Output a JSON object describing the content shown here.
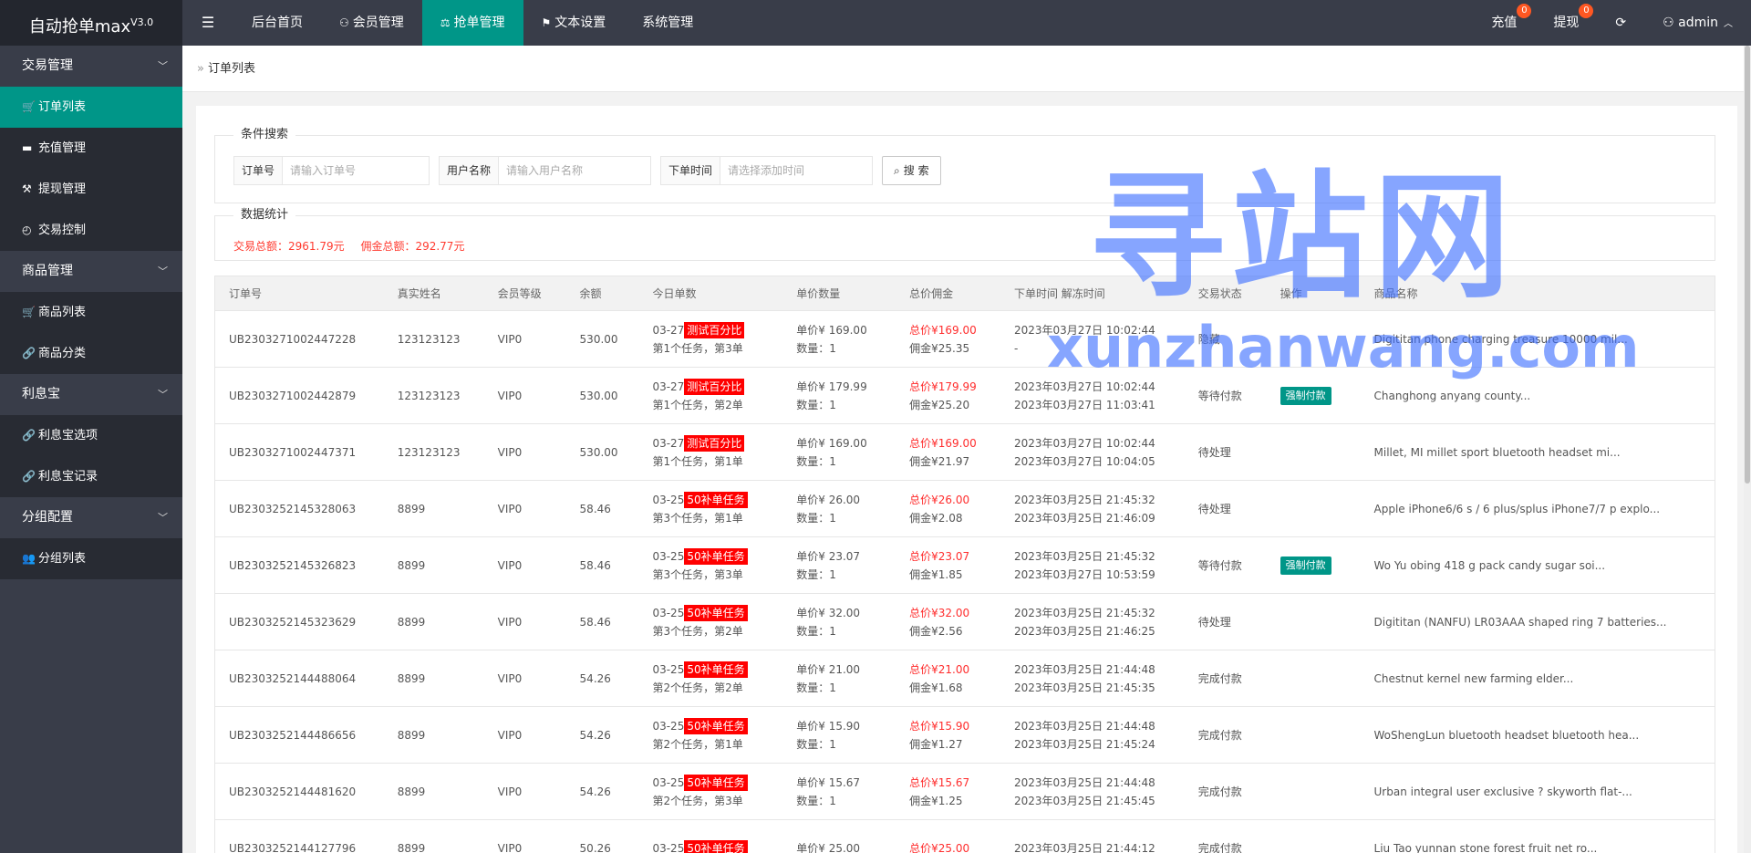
{
  "header": {
    "logo": "自动抢单max",
    "version": "V3.0",
    "menu_toggle_icon": "menu-icon",
    "nav": [
      {
        "label": "后台首页",
        "icon": ""
      },
      {
        "label": "会员管理",
        "icon": "user-icon"
      },
      {
        "label": "抢单管理",
        "icon": "balance-scale-icon"
      },
      {
        "label": "文本设置",
        "icon": "flag-icon"
      },
      {
        "label": "系统管理",
        "icon": ""
      }
    ],
    "active_nav": "抢单管理",
    "right": {
      "recharge": {
        "label": "充值",
        "badge": "0"
      },
      "withdraw": {
        "label": "提现",
        "badge": "0"
      },
      "refresh_icon": "refresh-icon",
      "user": "admin"
    }
  },
  "sidebar": {
    "groups": [
      {
        "label": "交易管理",
        "items": [
          {
            "label": "订单列表",
            "icon": "cart-icon",
            "active": true
          },
          {
            "label": "充值管理",
            "icon": "card-icon"
          },
          {
            "label": "提现管理",
            "icon": "hammer-icon"
          },
          {
            "label": "交易控制",
            "icon": "dashboard-icon"
          }
        ]
      },
      {
        "label": "商品管理",
        "items": [
          {
            "label": "商品列表",
            "icon": "cart-icon"
          },
          {
            "label": "商品分类",
            "icon": "link-icon"
          }
        ]
      },
      {
        "label": "利息宝",
        "items": [
          {
            "label": "利息宝选项",
            "icon": "link-icon"
          },
          {
            "label": "利息宝记录",
            "icon": "link-icon"
          }
        ]
      },
      {
        "label": "分组配置",
        "items": [
          {
            "label": "分组列表",
            "icon": "users-icon"
          }
        ]
      }
    ]
  },
  "breadcrumb": "订单列表",
  "search": {
    "legend": "条件搜索",
    "order_label": "订单号",
    "order_placeholder": "请输入订单号",
    "user_label": "用户名称",
    "user_placeholder": "请输入用户名称",
    "time_label": "下单时间",
    "time_placeholder": "请选择添加时间",
    "button": "搜 索"
  },
  "stats": {
    "legend": "数据统计",
    "total_trade": "交易总额：2961.79元",
    "total_commission": "佣金总额：292.77元"
  },
  "table": {
    "headers": [
      "订单号",
      "真实姓名",
      "会员等级",
      "余额",
      "今日单数",
      "单价数量",
      "总价佣金",
      "下单时间 解冻时间",
      "交易状态",
      "操作",
      "商品名称"
    ],
    "rows": [
      {
        "id": "UB2303271002447228",
        "name": "123123123",
        "level": "VIP0",
        "balance": "530.00",
        "date": "03-27",
        "tag": "测试百分比",
        "task": "第1个任务，第3单",
        "price": "单价¥  169.00",
        "qty": "数量：1",
        "total": "总价¥169.00",
        "commission": "佣金¥25.35",
        "time1": "2023年03月27日 10:02:44",
        "time2": "-",
        "status": "隐藏",
        "action": "",
        "product": "Digititan phone charging treasure 10000 mil..."
      },
      {
        "id": "UB2303271002442879",
        "name": "123123123",
        "level": "VIP0",
        "balance": "530.00",
        "date": "03-27",
        "tag": "测试百分比",
        "task": "第1个任务，第2单",
        "price": "单价¥  179.99",
        "qty": "数量：1",
        "total": "总价¥179.99",
        "commission": "佣金¥25.20",
        "time1": "2023年03月27日 10:02:44",
        "time2": "2023年03月27日 11:03:41",
        "status": "等待付款",
        "action": "强制付款",
        "product": "Changhong anyang county..."
      },
      {
        "id": "UB2303271002447371",
        "name": "123123123",
        "level": "VIP0",
        "balance": "530.00",
        "date": "03-27",
        "tag": "测试百分比",
        "task": "第1个任务，第1单",
        "price": "单价¥  169.00",
        "qty": "数量：1",
        "total": "总价¥169.00",
        "commission": "佣金¥21.97",
        "time1": "2023年03月27日 10:02:44",
        "time2": "2023年03月27日 10:04:05",
        "status": "待处理",
        "action": "",
        "product": "Millet, MI millet sport bluetooth headset mi..."
      },
      {
        "id": "UB2303252145328063",
        "name": "8899",
        "level": "VIP0",
        "balance": "58.46",
        "date": "03-25",
        "tag": "50补单任务",
        "task": "第3个任务，第1单",
        "price": "单价¥  26.00",
        "qty": "数量：1",
        "total": "总价¥26.00",
        "commission": "佣金¥2.08",
        "time1": "2023年03月25日 21:45:32",
        "time2": "2023年03月25日 21:46:09",
        "status": "待处理",
        "action": "",
        "product": "Apple iPhone6/6 s / 6 plus/splus iPhone7/7 p explo..."
      },
      {
        "id": "UB2303252145326823",
        "name": "8899",
        "level": "VIP0",
        "balance": "58.46",
        "date": "03-25",
        "tag": "50补单任务",
        "task": "第3个任务，第3单",
        "price": "单价¥  23.07",
        "qty": "数量：1",
        "total": "总价¥23.07",
        "commission": "佣金¥1.85",
        "time1": "2023年03月25日 21:45:32",
        "time2": "2023年03月27日 10:53:59",
        "status": "等待付款",
        "action": "强制付款",
        "product": "Wo Yu obing 418 g pack candy sugar soi..."
      },
      {
        "id": "UB2303252145323629",
        "name": "8899",
        "level": "VIP0",
        "balance": "58.46",
        "date": "03-25",
        "tag": "50补单任务",
        "task": "第3个任务，第2单",
        "price": "单价¥  32.00",
        "qty": "数量：1",
        "total": "总价¥32.00",
        "commission": "佣金¥2.56",
        "time1": "2023年03月25日 21:45:32",
        "time2": "2023年03月25日 21:46:25",
        "status": "待处理",
        "action": "",
        "product": "Digititan (NANFU) LR03AAA shaped ring 7 batteries..."
      },
      {
        "id": "UB2303252144488064",
        "name": "8899",
        "level": "VIP0",
        "balance": "54.26",
        "date": "03-25",
        "tag": "50补单任务",
        "task": "第2个任务，第2单",
        "price": "单价¥  21.00",
        "qty": "数量：1",
        "total": "总价¥21.00",
        "commission": "佣金¥1.68",
        "time1": "2023年03月25日 21:44:48",
        "time2": "2023年03月25日 21:45:35",
        "status": "完成付款",
        "action": "",
        "product": "Chestnut kernel new farming elder..."
      },
      {
        "id": "UB2303252144486656",
        "name": "8899",
        "level": "VIP0",
        "balance": "54.26",
        "date": "03-25",
        "tag": "50补单任务",
        "task": "第2个任务，第1单",
        "price": "单价¥  15.90",
        "qty": "数量：1",
        "total": "总价¥15.90",
        "commission": "佣金¥1.27",
        "time1": "2023年03月25日 21:44:48",
        "time2": "2023年03月25日 21:45:24",
        "status": "完成付款",
        "action": "",
        "product": "WoShengLun bluetooth headset bluetooth hea..."
      },
      {
        "id": "UB2303252144481620",
        "name": "8899",
        "level": "VIP0",
        "balance": "54.26",
        "date": "03-25",
        "tag": "50补单任务",
        "task": "第2个任务，第3单",
        "price": "单价¥  15.67",
        "qty": "数量：1",
        "total": "总价¥15.67",
        "commission": "佣金¥1.25",
        "time1": "2023年03月25日 21:44:48",
        "time2": "2023年03月25日 21:45:45",
        "status": "完成付款",
        "action": "",
        "product": "Urban integral user exclusive ? skyworth flat-..."
      },
      {
        "id": "UB2303252144127796",
        "name": "8899",
        "level": "VIP0",
        "balance": "50.26",
        "date": "03-25",
        "tag": "50补单任务",
        "task": "",
        "price": "单价¥  25.00",
        "qty": "",
        "total": "总价¥25.00",
        "commission": "",
        "time1": "2023年03月25日 21:44:12",
        "time2": "",
        "status": "完成付款",
        "action": "",
        "product": "Liu Tao yunnan stone forest fruit net ro..."
      }
    ]
  },
  "watermark": {
    "line1": "寻站网",
    "line2": "xunzhanwang.com"
  }
}
